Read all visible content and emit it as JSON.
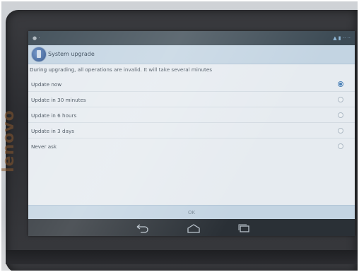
{
  "dialog": {
    "title": "System upgrade",
    "message": "During upgrading, all operations are invalid. It will take several minutes",
    "options": [
      {
        "label": "Update now",
        "checked": true
      },
      {
        "label": "Update in 30 minutes",
        "checked": false
      },
      {
        "label": "Update in 6 hours",
        "checked": false
      },
      {
        "label": "Update in 3 days",
        "checked": false
      },
      {
        "label": "Never ask",
        "checked": false
      }
    ],
    "ok_label": "OK"
  },
  "device": {
    "brand": "lenovo"
  },
  "icons": {
    "app_icon": "system-upgrade-icon",
    "back": "back-icon",
    "home": "home-icon",
    "recent": "recent-apps-icon"
  },
  "colors": {
    "header_bg": "#c3d4e2",
    "screen_bg": "#e6ebf0",
    "accent": "#4d82b8",
    "nav_bg": "#2a3036"
  }
}
